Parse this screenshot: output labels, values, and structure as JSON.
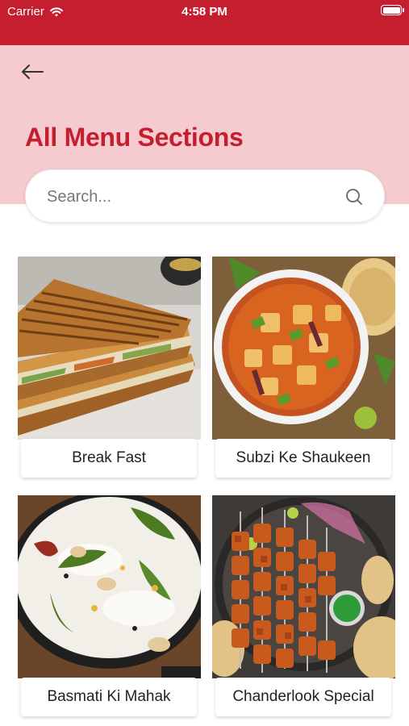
{
  "status_bar": {
    "carrier": "Carrier",
    "time": "4:58 PM"
  },
  "header": {
    "title": "All Menu Sections",
    "back_icon": "arrow-left-icon"
  },
  "search": {
    "placeholder": "Search...",
    "value": "",
    "icon": "search-icon"
  },
  "colors": {
    "accent": "#c41e2f",
    "header_bg": "#f6cbd0"
  },
  "sections": [
    {
      "label": "Break Fast"
    },
    {
      "label": "Subzi Ke Shaukeen"
    },
    {
      "label": "Basmati Ki Mahak"
    },
    {
      "label": "Chanderlook Special"
    }
  ]
}
